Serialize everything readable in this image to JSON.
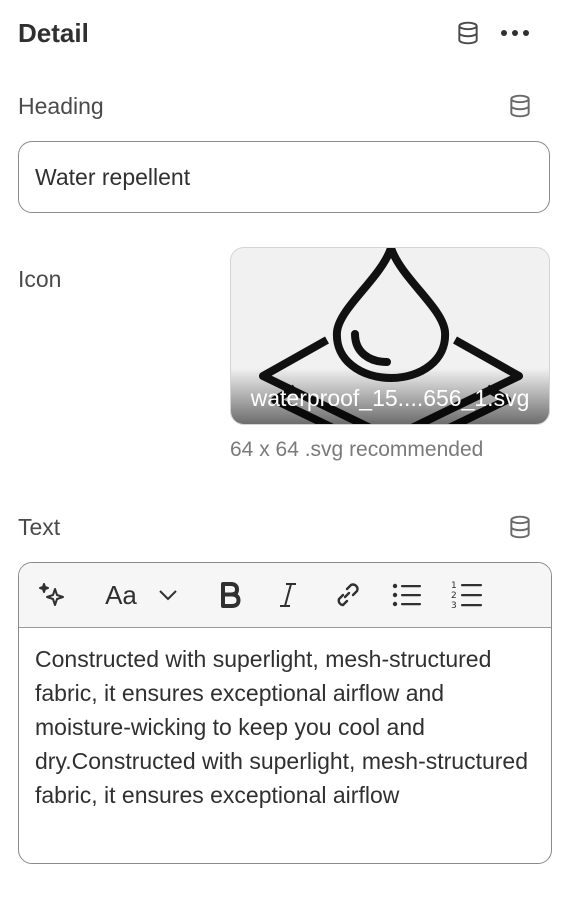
{
  "header": {
    "title": "Detail"
  },
  "heading": {
    "label": "Heading",
    "value": "Water repellent"
  },
  "icon": {
    "label": "Icon",
    "filename": "waterproof_15....656_1.svg",
    "hint": "64 x 64 .svg recommended"
  },
  "text": {
    "label": "Text",
    "content": "Constructed with superlight, mesh-structured fabric, it ensures exceptional airflow and moisture-wicking to keep you cool and dry.Constructed with superlight, mesh-structured fabric, it ensures exceptional airflow",
    "toolbar": {
      "font_label": "Aa"
    }
  }
}
